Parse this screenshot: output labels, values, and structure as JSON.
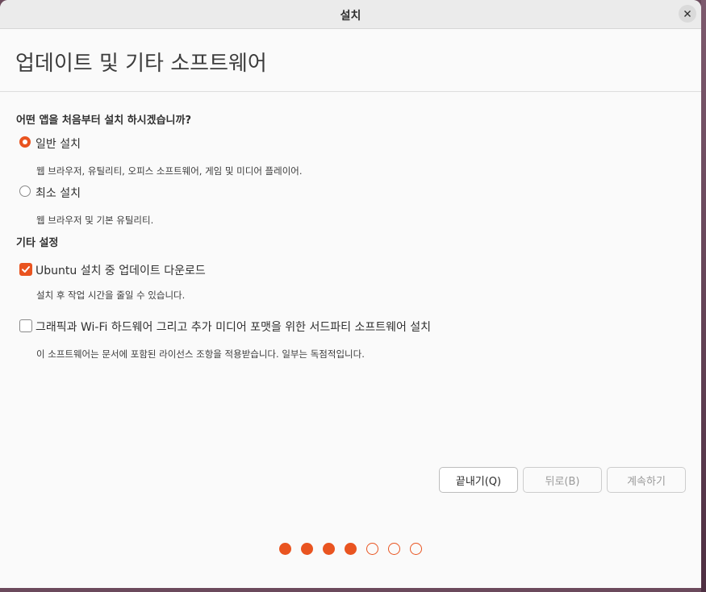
{
  "window": {
    "title": "설치"
  },
  "header": {
    "title": "업데이트 및 기타 소프트웨어"
  },
  "install_type": {
    "question": "어떤 앱을 처음부터 설치 하시겠습니까?",
    "options": [
      {
        "label": "일반 설치",
        "description": "웹 브라우저, 유틸리티, 오피스  소프트웨어, 게임 및 미디어 플레이어.",
        "selected": true
      },
      {
        "label": "최소 설치",
        "description": "웹 브라우저 및 기본 유틸리티.",
        "selected": false
      }
    ]
  },
  "other_settings": {
    "title": "기타 설정",
    "options": [
      {
        "label": "Ubuntu 설치 중 업데이트 다운로드",
        "description": "설치 후 작업 시간을 줄일 수 있습니다.",
        "checked": true
      },
      {
        "label": "그래픽과 Wi-Fi 하드웨어 그리고 추가 미디어 포맷을 위한 서드파티 소프트웨어 설치",
        "description": "이 소프트웨어는 문서에 포함된 라이선스 조항을 적용받습니다. 일부는 독점적입니다.",
        "checked": false
      }
    ]
  },
  "buttons": {
    "quit": "끝내기(Q)",
    "back": "뒤로(B)",
    "continue": "계속하기"
  },
  "progress": {
    "completed_steps": 4,
    "total_steps": 7
  },
  "colors": {
    "accent": "#e95420"
  }
}
